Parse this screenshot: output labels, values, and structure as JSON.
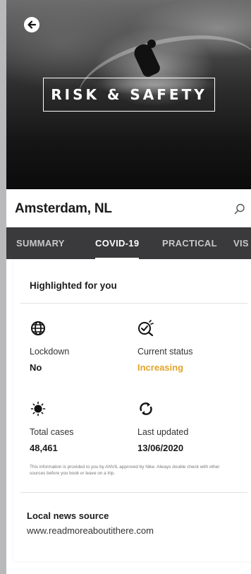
{
  "hero": {
    "title": "RISK & SAFETY",
    "back_icon": "arrow-left-icon"
  },
  "location": {
    "city": "Amsterdam, NL",
    "search_icon": "search-icon"
  },
  "tabs": [
    {
      "label": "SUMMARY",
      "active": false
    },
    {
      "label": "COVID-19",
      "active": true
    },
    {
      "label": "PRACTICAL",
      "active": false
    },
    {
      "label": "VIS",
      "active": false
    }
  ],
  "highlights": {
    "heading": "Highlighted for you",
    "stats": [
      {
        "icon": "globe-icon",
        "label": "Lockdown",
        "value": "No"
      },
      {
        "icon": "status-check-icon",
        "label": "Current status",
        "value": "Increasing",
        "value_color": "#e3a429"
      },
      {
        "icon": "virus-icon",
        "label": "Total cases",
        "value": "48,461"
      },
      {
        "icon": "refresh-icon",
        "label": "Last updated",
        "value": "13/06/2020"
      }
    ],
    "disclaimer": "This information is provided to you by ANVIL approved by Nike. Always double check with other sources before you book or leave on a trip."
  },
  "news": {
    "heading": "Local news source",
    "link": "www.readmoreaboutithere.com"
  },
  "colors": {
    "tabbar_bg": "#3a3a3c",
    "status_increasing": "#e3a429"
  }
}
